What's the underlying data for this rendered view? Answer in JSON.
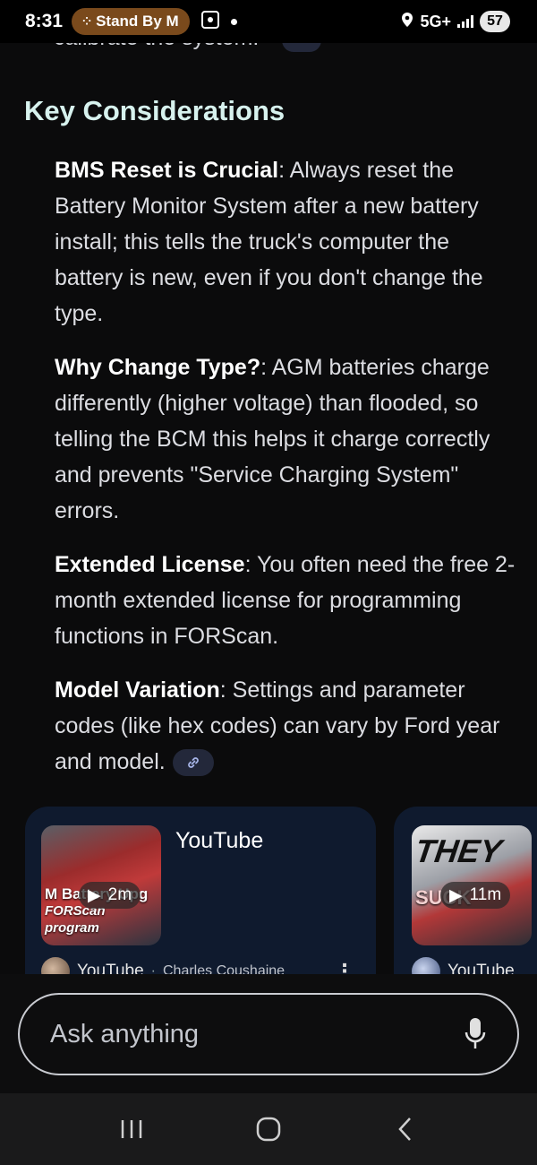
{
  "status_bar": {
    "time": "8:31",
    "media_pill": "Stand By M",
    "network": "5G+",
    "battery": "57"
  },
  "content": {
    "partial_line": "calibrate the system.",
    "heading": "Key Considerations",
    "bullets": [
      {
        "title": "BMS Reset is Crucial",
        "text": ": Always reset the Battery Monitor System after a new battery install; this tells the truck's computer the battery is new, even if you don't change the type."
      },
      {
        "title": "Why Change Type?",
        "text": ": AGM batteries charge differently (higher voltage) than flooded, so telling the BCM this helps it charge correctly and prevents \"Service Charging System\" errors."
      },
      {
        "title": "Extended License",
        "text": ": You often need the free 2-month extended license for programming functions in FORScan."
      },
      {
        "title": "Model Variation",
        "text": ": Settings and parameter codes (like hex codes) can vary by Ford year and model."
      }
    ]
  },
  "cards": [
    {
      "title": "YouTube",
      "duration": "2m",
      "thumb_text_line1": "M Battery Upg",
      "thumb_text_line2": "FORScan program",
      "source": "YouTube",
      "separator": "·",
      "author": "Charles Coushaine"
    },
    {
      "title": "",
      "duration": "11m",
      "thumb_big_text": "THEY",
      "thumb_text_line1": "SUCK",
      "source": "YouTube"
    }
  ],
  "ask": {
    "placeholder": "Ask anything"
  },
  "colors": {
    "background": "#0b0b0c",
    "heading": "#d7f2ee",
    "card_bg": "#0f1a2e",
    "pill_bg": "#7a4a1c",
    "chip_bg": "#23283a"
  },
  "icons": [
    "media-dots-icon",
    "screenshot-icon",
    "location-icon",
    "signal-icon",
    "link-icon",
    "play-icon",
    "kebab-menu-icon",
    "mic-icon",
    "recents-icon",
    "home-icon",
    "back-icon"
  ]
}
